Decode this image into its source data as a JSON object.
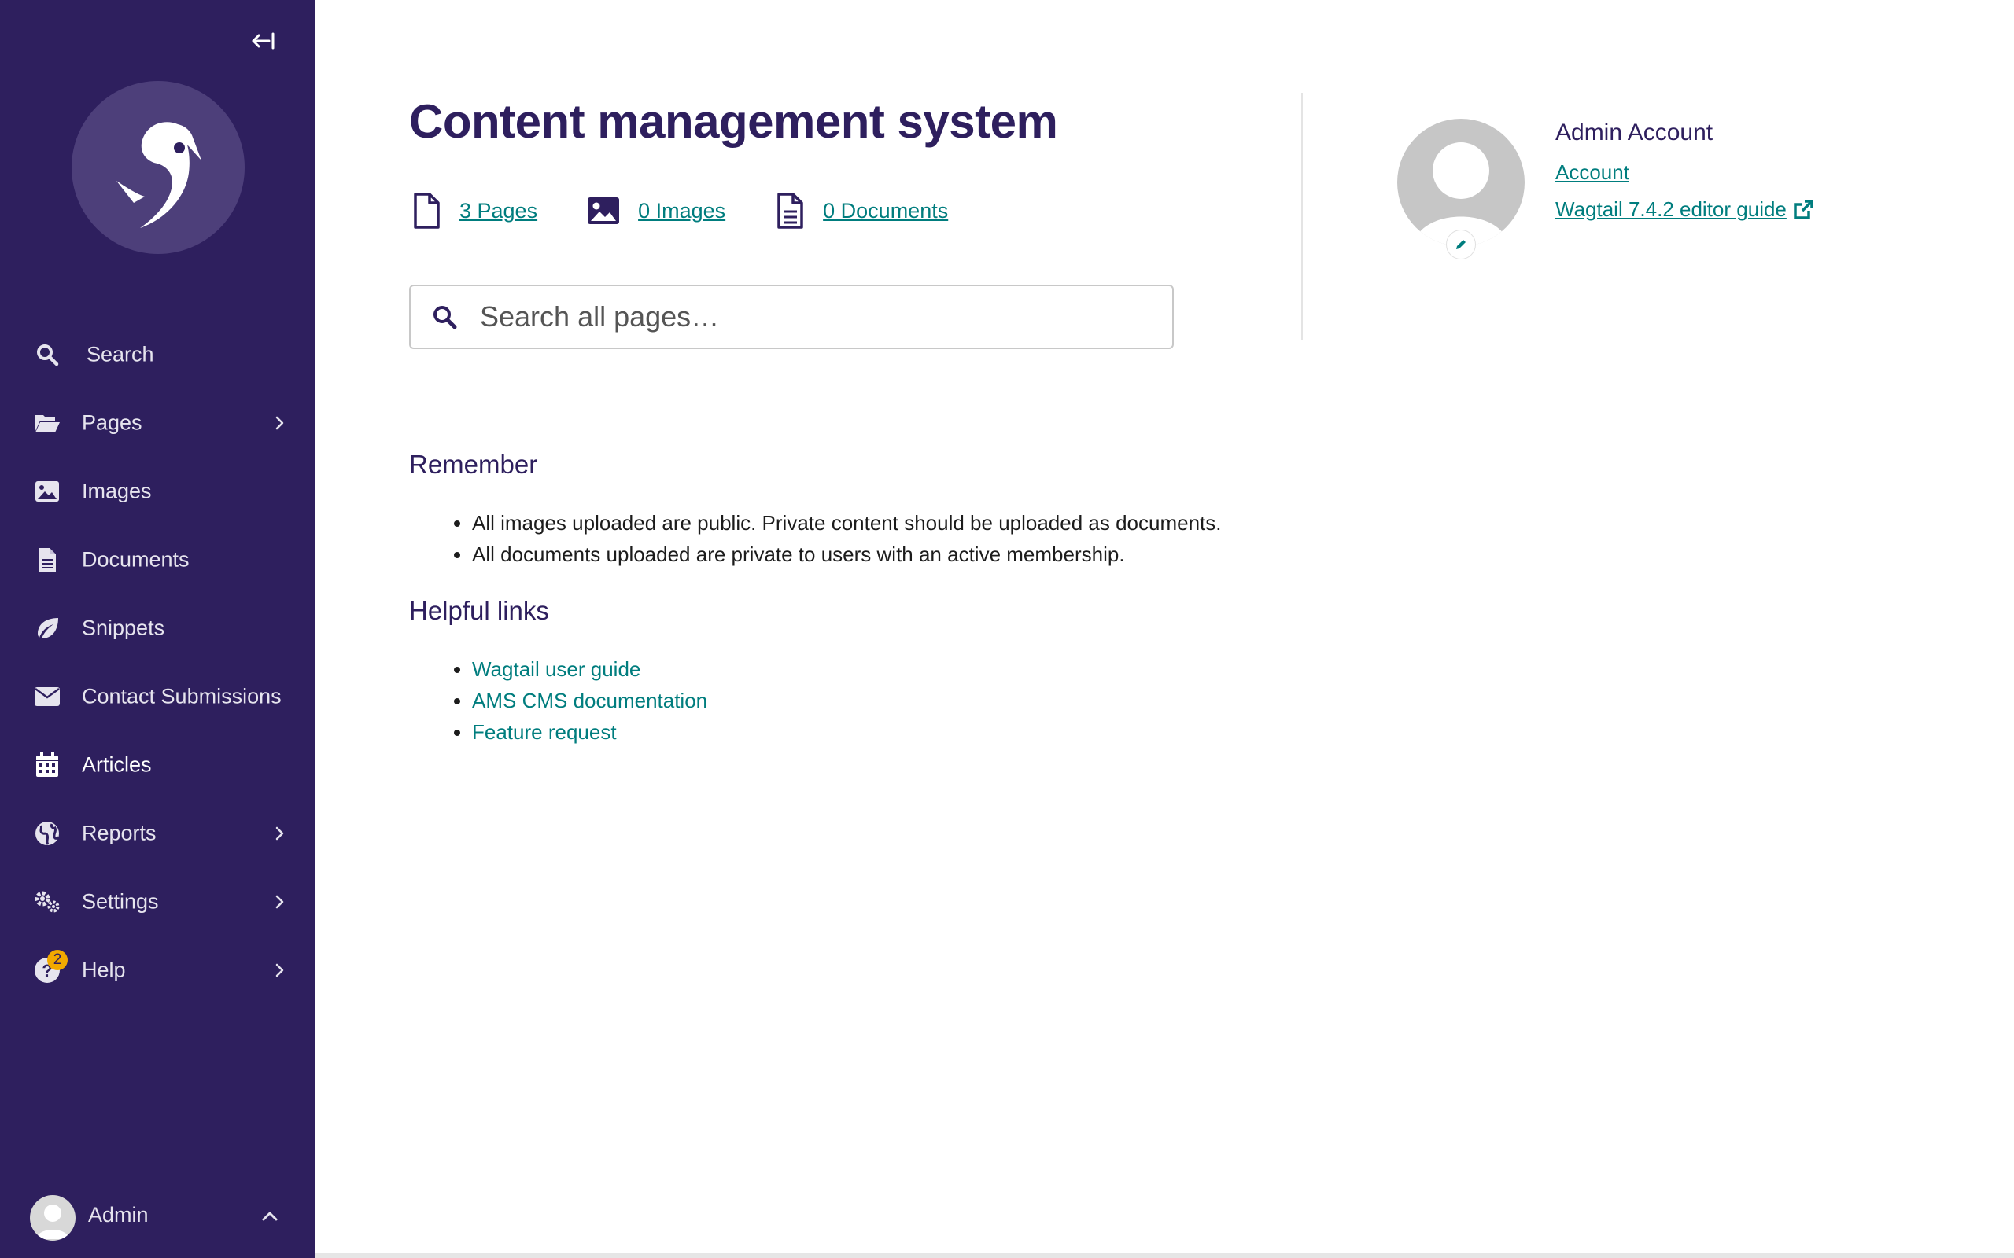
{
  "sidebar": {
    "collapse_label": "Collapse sidebar",
    "items": [
      {
        "label": "Search",
        "icon": "search-icon"
      },
      {
        "label": "Pages",
        "icon": "folder-open-icon"
      },
      {
        "label": "Images",
        "icon": "image-icon"
      },
      {
        "label": "Documents",
        "icon": "document-icon"
      },
      {
        "label": "Snippets",
        "icon": "snippet-icon"
      },
      {
        "label": "Contact Submissions",
        "icon": "envelope-icon"
      },
      {
        "label": "Articles",
        "icon": "calendar-icon"
      },
      {
        "label": "Reports",
        "icon": "globe-icon"
      },
      {
        "label": "Settings",
        "icon": "cogs-icon"
      },
      {
        "label": "Help",
        "icon": "help-icon",
        "badge": "2"
      }
    ],
    "account": {
      "name": "Admin"
    }
  },
  "main": {
    "title": "Content management system",
    "summary": [
      {
        "label": "3 Pages",
        "icon": "page-icon"
      },
      {
        "label": "0 Images",
        "icon": "image-icon"
      },
      {
        "label": "0 Documents",
        "icon": "document-icon"
      }
    ],
    "search": {
      "placeholder": "Search all pages…"
    },
    "profile": {
      "name": "Admin Account",
      "account_link": "Account",
      "guide_link": "Wagtail 7.4.2 editor guide"
    },
    "remember": {
      "heading": "Remember",
      "items": [
        "All images uploaded are public. Private content should be uploaded as documents.",
        "All documents uploaded are private to users with an active membership."
      ]
    },
    "helpful": {
      "heading": "Helpful links",
      "links": [
        "Wagtail user guide",
        "AMS CMS documentation",
        "Feature request"
      ]
    }
  },
  "colors": {
    "sidebar_bg": "#2e1f5e",
    "accent_link": "#007d7e",
    "heading": "#2e1f5e",
    "badge": "#f2a900"
  }
}
